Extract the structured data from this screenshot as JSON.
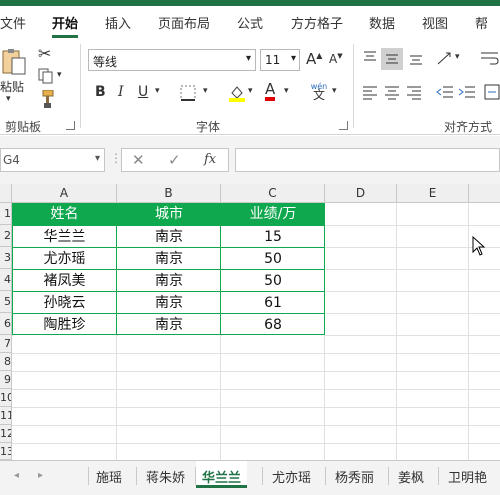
{
  "ribbon_tabs": [
    "文件",
    "开始",
    "插入",
    "页面布局",
    "公式",
    "方方格子",
    "数据",
    "视图",
    "帮"
  ],
  "active_tab": "开始",
  "clipboard": {
    "paste_label": "粘贴",
    "group_label": "剪贴板"
  },
  "font": {
    "name": "等线",
    "size": "11",
    "bold": "B",
    "italic": "I",
    "underline": "U",
    "font_color_label": "A",
    "group_label": "字体",
    "wen_label": "wén",
    "wen_char": "文"
  },
  "alignment": {
    "group_label": "对齐方式"
  },
  "formula_bar": {
    "name_box": "G4",
    "fx_label": "fx",
    "formula_value": ""
  },
  "columns": [
    "A",
    "B",
    "C",
    "D",
    "E"
  ],
  "row_numbers": [
    "1",
    "2",
    "3",
    "4",
    "5",
    "6",
    "7",
    "8",
    "9",
    "10",
    "11",
    "12",
    "13"
  ],
  "table": {
    "headers": [
      "姓名",
      "城市",
      "业绩/万"
    ],
    "rows": [
      [
        "华兰兰",
        "南京",
        "15"
      ],
      [
        "尤亦瑶",
        "南京",
        "50"
      ],
      [
        "褚凤美",
        "南京",
        "50"
      ],
      [
        "孙晓云",
        "南京",
        "61"
      ],
      [
        "陶胜珍",
        "南京",
        "68"
      ]
    ]
  },
  "sheet_tabs": [
    "施瑶",
    "蒋朱娇",
    "华兰兰",
    "尤亦瑶",
    "杨秀丽",
    "姜枫",
    "卫明艳"
  ],
  "active_sheet": "华兰兰",
  "colors": {
    "accent": "#217346",
    "header_fill": "#10a84e"
  }
}
